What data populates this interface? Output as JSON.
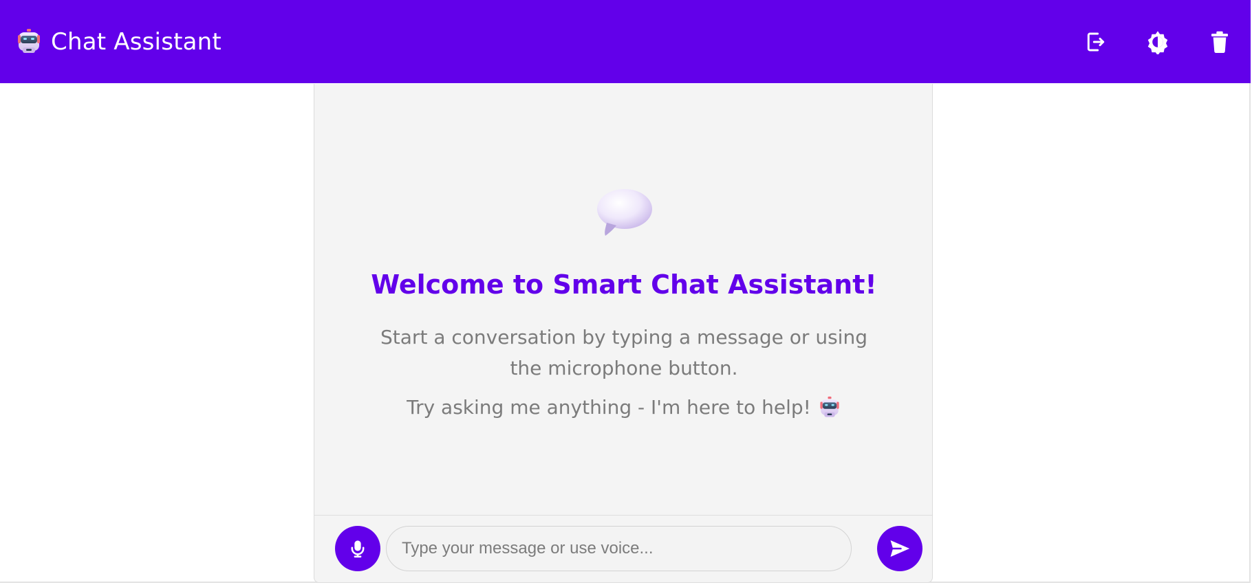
{
  "header": {
    "title": "Chat Assistant",
    "logo_icon": "robot-icon",
    "actions": [
      {
        "name": "logout-icon"
      },
      {
        "name": "theme-toggle-icon"
      },
      {
        "name": "trash-icon"
      }
    ],
    "background": "#6200ea"
  },
  "welcome": {
    "icon": "speech-bubble-icon",
    "title": "Welcome to Smart Chat Assistant!",
    "line_1": "Start a conversation by typing a message or using the microphone button.",
    "line_2": "Try asking me anything - I'm here to help!",
    "line_2_icon": "robot-icon",
    "accent": "#6200ea"
  },
  "composer": {
    "placeholder": "Type your message or use voice...",
    "mic_icon": "microphone-icon",
    "send_icon": "send-icon"
  }
}
